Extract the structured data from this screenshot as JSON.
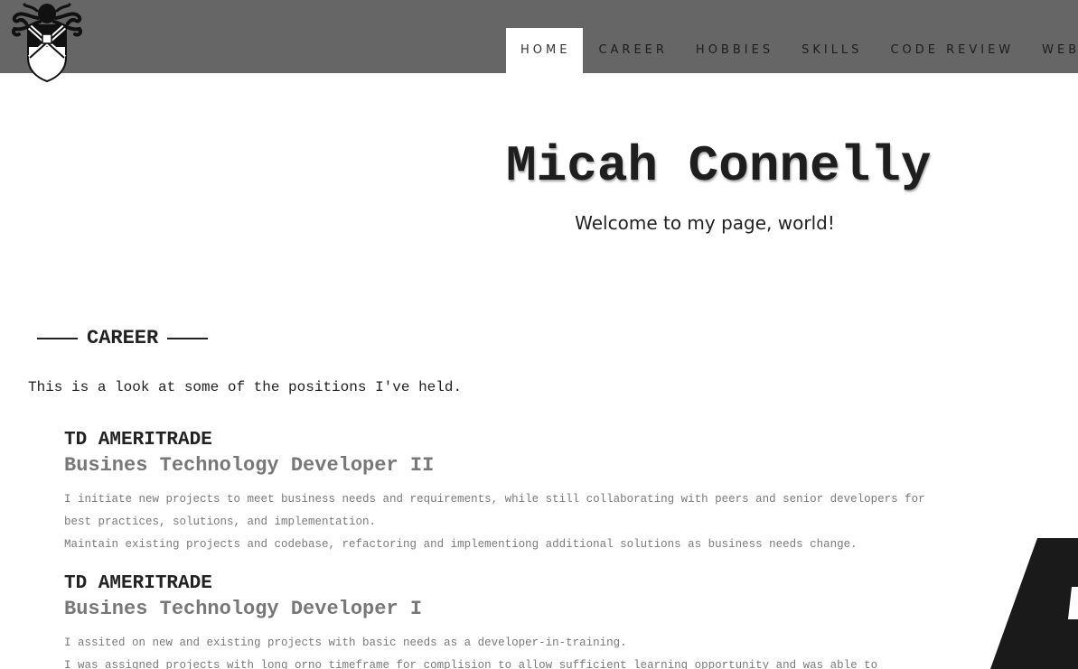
{
  "nav": {
    "items": [
      "HOME",
      "CAREER",
      "HOBBIES",
      "SKILLS",
      "CODE REVIEW",
      "WEBS"
    ],
    "active_index": 0
  },
  "hero": {
    "title": "Micah Connelly",
    "subtitle": "Welcome to my page, world!"
  },
  "career": {
    "heading": "CAREER",
    "intro": "This is a look at some of the positions I've held.",
    "jobs": [
      {
        "company": "TD AMERITRADE",
        "title": "Busines Technology Developer II",
        "lines": [
          "I initiate new projects to meet business needs and requirements, while still collaborating with peers and senior developers for best practices, solutions, and implementation.",
          "Maintain existing projects and codebase, refactoring and implementiong additional solutions as business needs change."
        ]
      },
      {
        "company": "TD AMERITRADE",
        "title": "Busines Technology Developer I",
        "lines": [
          "I assited on new and existing projects with basic needs as a developer-in-training.",
          "I was assigned projects with long orno timeframe for complision to allow sufficient learning opportunity and was able to research and"
        ]
      }
    ]
  },
  "colors": {
    "topbar": "#666666",
    "text": "#222222",
    "muted": "#777777"
  }
}
